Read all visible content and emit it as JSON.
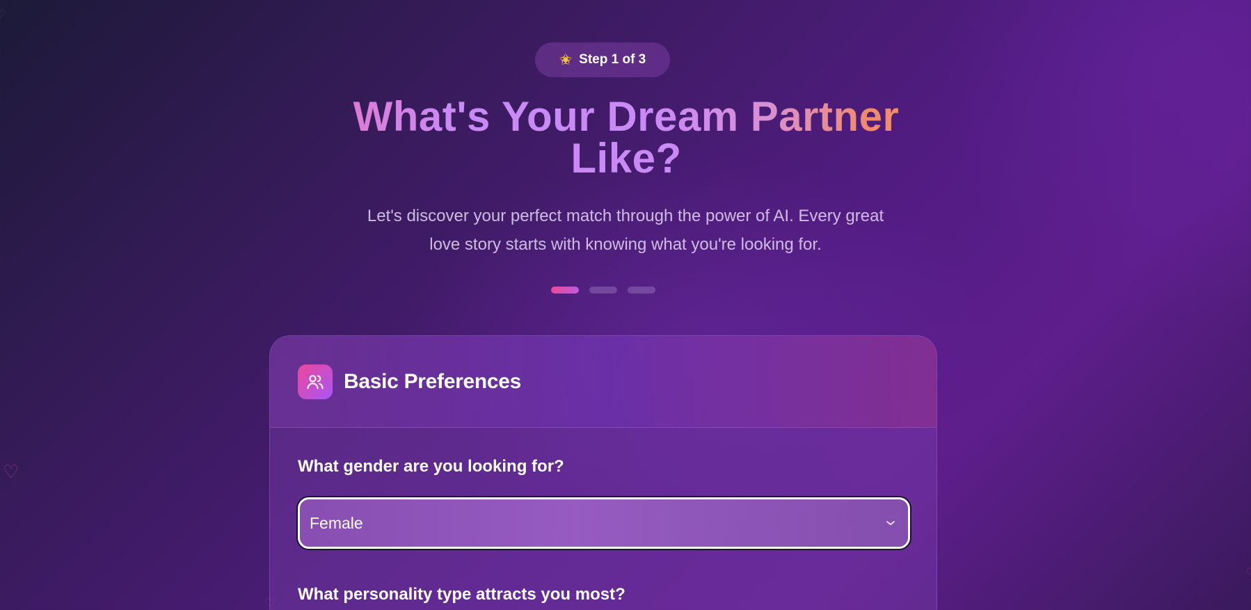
{
  "step": {
    "label": "Step 1 of 3",
    "icon": "sparkles-icon"
  },
  "headline": {
    "line1": "What's Your Dream Partner",
    "line2": "Like?"
  },
  "subtitle": {
    "line1": "Let's discover your perfect match through the power of AI. Every great",
    "line2": "love story starts with knowing what you're looking for."
  },
  "progress": {
    "current_step": 1,
    "total_steps": 3
  },
  "card": {
    "title": "Basic Preferences",
    "icon": "users-icon",
    "questions": [
      {
        "label": "What gender are you looking for?",
        "selected": "Female"
      },
      {
        "label": "What personality type attracts you most?"
      }
    ]
  },
  "colors": {
    "accent_pink": "#ec4899",
    "accent_purple": "#a855f7",
    "headline_lavender": "#c98af5",
    "headline_orange": "#f49a6a"
  }
}
